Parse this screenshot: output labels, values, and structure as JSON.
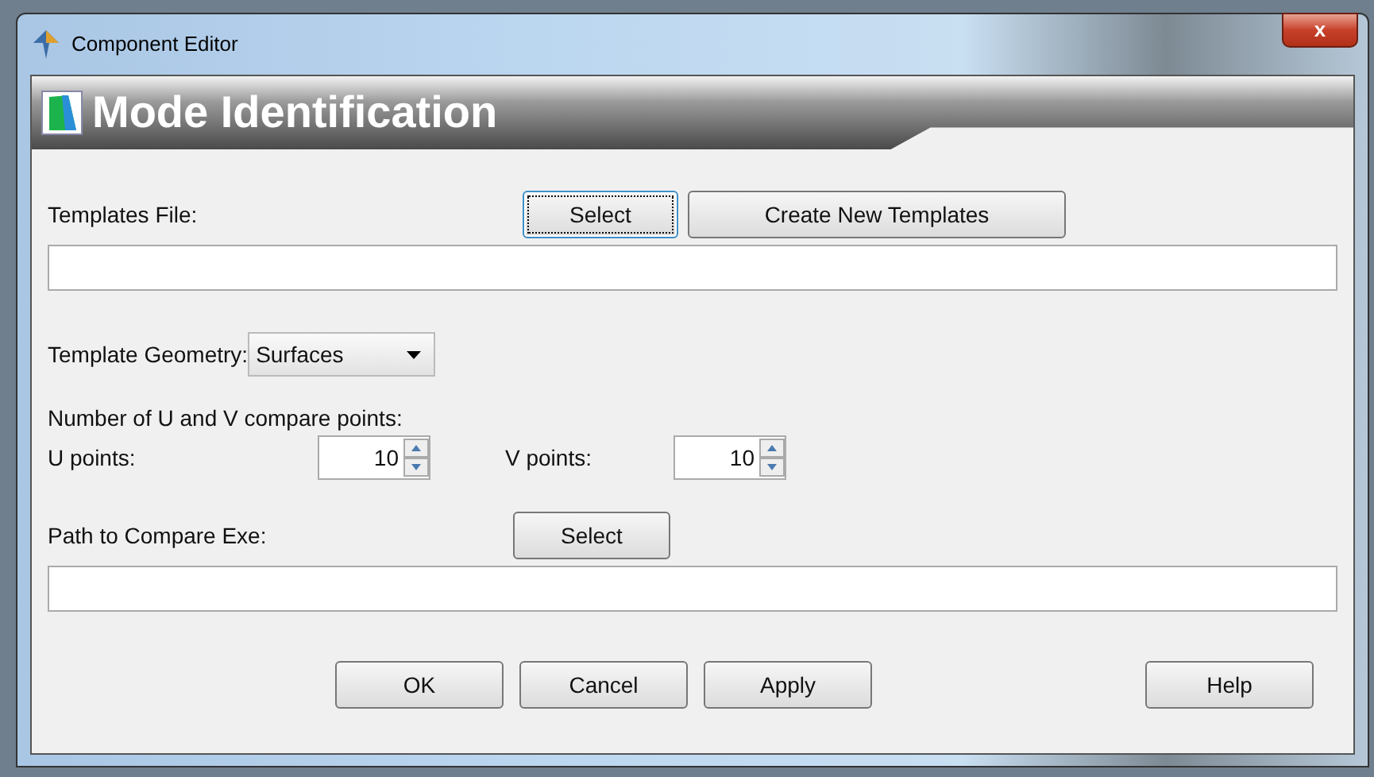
{
  "window": {
    "title": "Component Editor",
    "close": "x"
  },
  "header": {
    "title": "Mode Identification"
  },
  "templates_file": {
    "label": "Templates File:",
    "buttons": [
      {
        "label": "Select",
        "focused": true
      },
      {
        "label": "Create New Templates",
        "focused": false
      }
    ]
  },
  "template_geometry": {
    "label": "Template Geometry:",
    "value": "Surfaces"
  },
  "compare_points": {
    "label": "Number of U and V compare points:",
    "spinners": [
      {
        "label": "U points:",
        "value": "10"
      },
      {
        "label": "V points:",
        "value": "10"
      }
    ]
  },
  "compare_exe": {
    "label": "Path to Compare Exe:",
    "button": {
      "label": "Select",
      "focused": false
    }
  },
  "buttons": [
    {
      "label": "OK",
      "kind": "left"
    },
    {
      "label": "Cancel",
      "kind": "left"
    },
    {
      "label": "Apply",
      "kind": "left"
    },
    {
      "label": "Help",
      "kind": "right"
    }
  ]
}
